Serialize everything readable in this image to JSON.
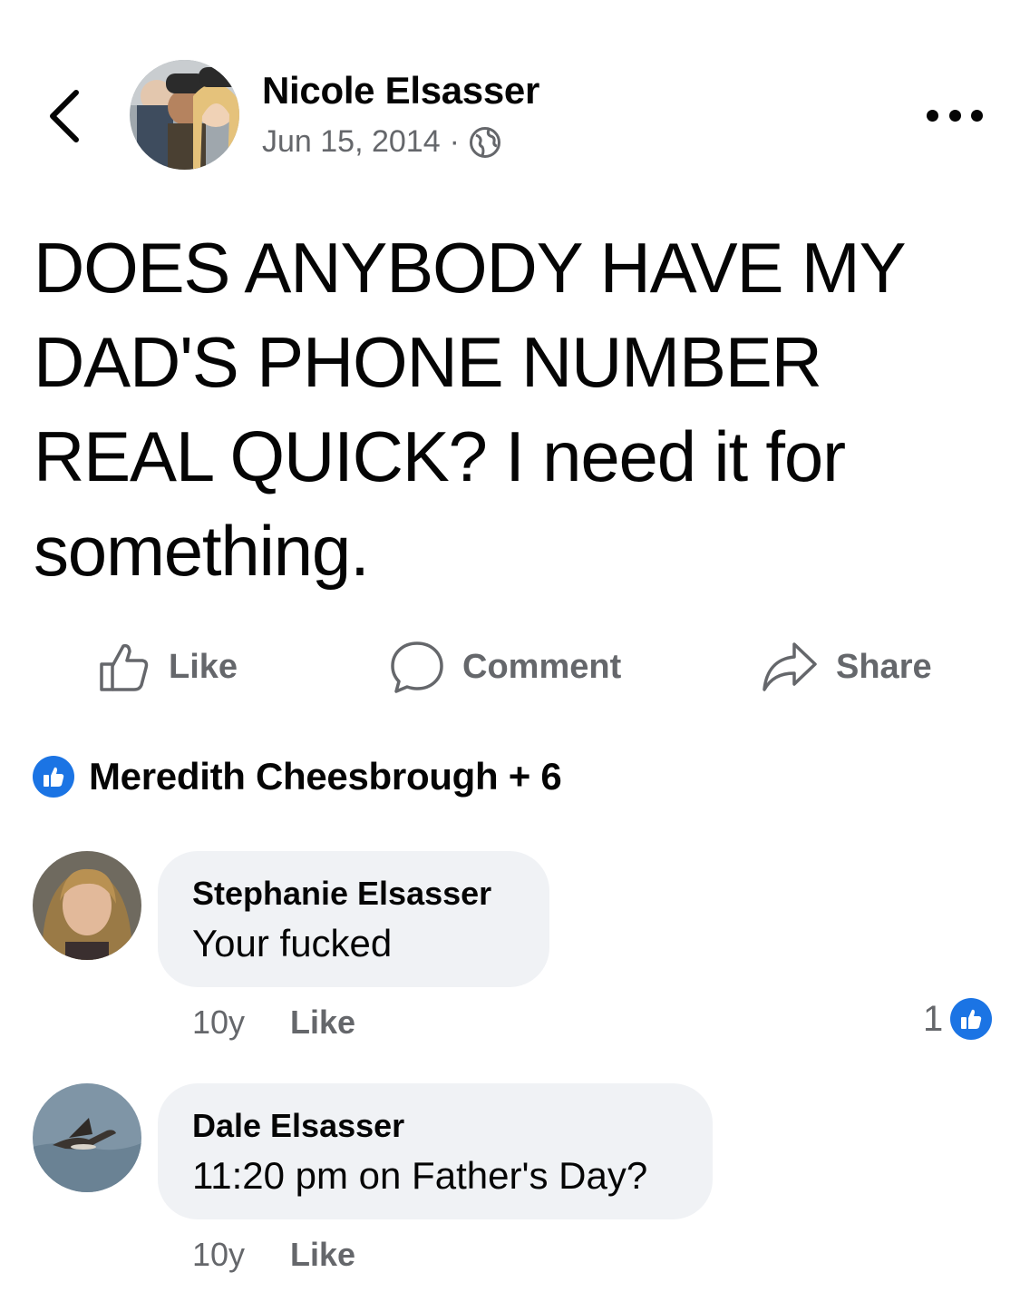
{
  "header": {
    "author_name": "Nicole Elsasser",
    "date": "Jun 15, 2014",
    "separator": "·",
    "privacy_icon": "globe-icon",
    "back_icon": "chevron-left-icon",
    "more_icon": "more-dots-icon"
  },
  "post": {
    "text": "DOES ANYBODY HAVE MY DAD'S PHONE NUMBER REAL QUICK? I need it for something."
  },
  "actions": {
    "like_label": "Like",
    "comment_label": "Comment",
    "share_label": "Share"
  },
  "reactions": {
    "summary": "Meredith Cheesbrough + 6",
    "icon": "thumbs-up-icon"
  },
  "comments": [
    {
      "author": "Stephanie Elsasser",
      "text": "Your fucked",
      "time": "10y",
      "like_label": "Like",
      "reaction_count": "1"
    },
    {
      "author": "Dale Elsasser",
      "text": "11:20 pm on Father's Day?",
      "time": "10y",
      "like_label": "Like"
    }
  ],
  "colors": {
    "accent": "#1b74e4",
    "secondary_text": "#65676b",
    "bubble": "#f0f2f5",
    "primary_text": "#050505"
  }
}
